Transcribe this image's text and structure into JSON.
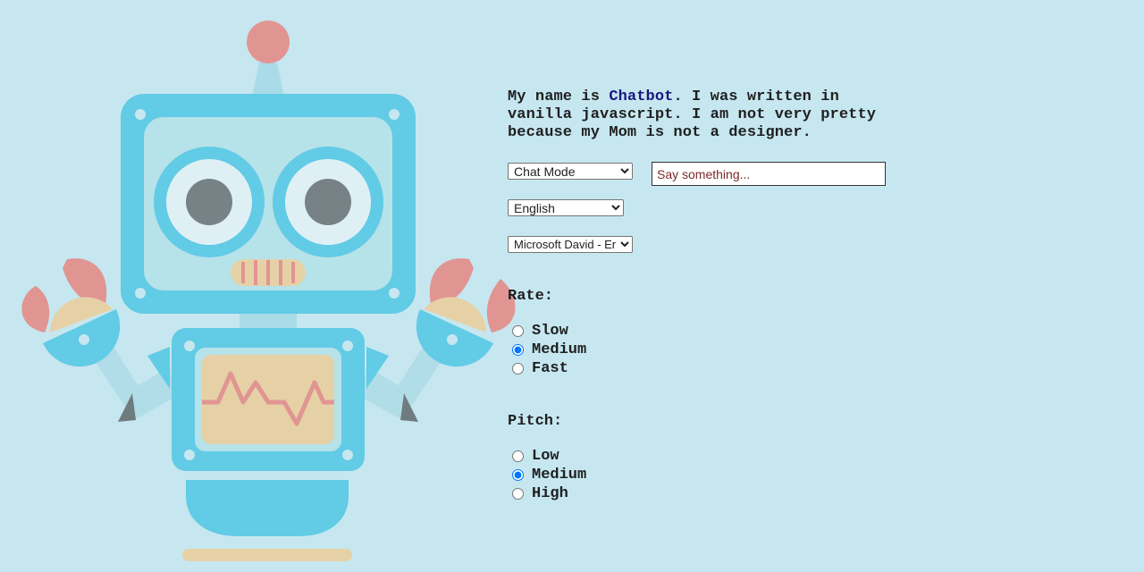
{
  "intro": {
    "prefix": "My name is ",
    "bot_name": "Chatbot",
    "suffix": ". I was written in vanilla javascript. I am not very pretty because my Mom is not a designer."
  },
  "mode_select": {
    "selected": "Chat Mode"
  },
  "say_input": {
    "placeholder": "Say something..."
  },
  "language_select": {
    "selected": "English"
  },
  "voice_select": {
    "selected": "Microsoft David - English (United States)"
  },
  "rate": {
    "label": "Rate:",
    "options": [
      "Slow",
      "Medium",
      "Fast"
    ],
    "selected": "Medium"
  },
  "pitch": {
    "label": "Pitch:",
    "options": [
      "Low",
      "Medium",
      "High"
    ],
    "selected": "Medium"
  },
  "colors": {
    "background": "#c6e7f0",
    "robot_blue": "#62cbe5",
    "robot_pink": "#e19592",
    "robot_sand": "#e6d1a6",
    "bot_name": "#1a1580"
  }
}
